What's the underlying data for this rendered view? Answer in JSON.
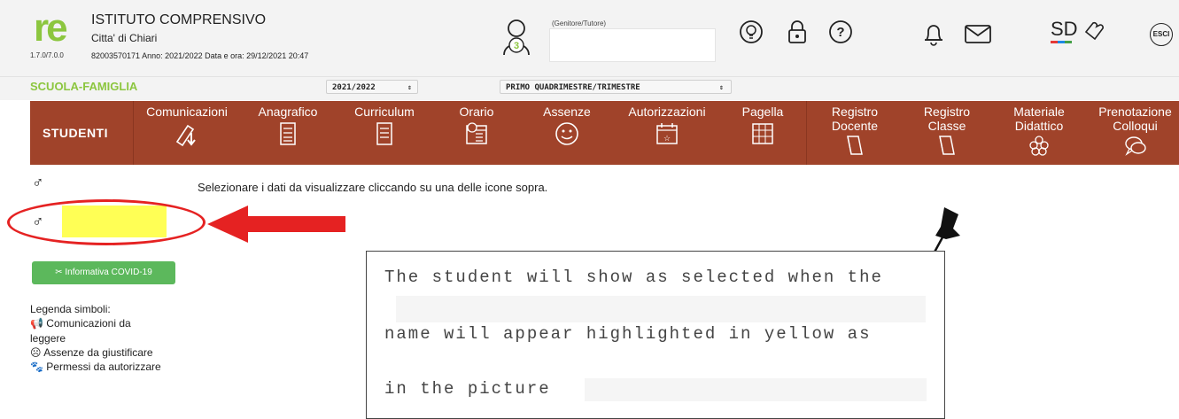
{
  "header": {
    "logo_text": "re",
    "version": "1.7.0/7.0.0",
    "school_name": "ISTITUTO COMPRENSIVO",
    "school_city": "Citta' di Chiari",
    "school_meta": "82003570171   Anno: 2021/2022  Data e ora: 29/12/2021 20:47",
    "user_badge": "3",
    "user_role": "(Genitore/Tutore)",
    "sd_label": "SD",
    "esci_label": "ESCI"
  },
  "subbar": {
    "title": "SCUOLA-FAMIGLIA",
    "year_select": "2021/2022",
    "period_select": "PRIMO QUADRIMESTRE/TRIMESTRE"
  },
  "nav": {
    "studenti": "STUDENTI",
    "items": [
      {
        "label": "Comunicazioni",
        "icon": "megaphone-icon"
      },
      {
        "label": "Anagrafico",
        "icon": "id-card-icon"
      },
      {
        "label": "Curriculum",
        "icon": "document-icon"
      },
      {
        "label": "Orario",
        "icon": "calendar-clock-icon"
      },
      {
        "label": "Assenze",
        "icon": "smiley-icon"
      },
      {
        "label": "Autorizzazioni",
        "icon": "calendar-star-icon"
      },
      {
        "label": "Pagella",
        "icon": "report-card-icon"
      },
      {
        "label_1": "Registro",
        "label_2": "Docente",
        "icon": "book-icon"
      },
      {
        "label_1": "Registro",
        "label_2": "Classe",
        "icon": "book-icon"
      },
      {
        "label_1": "Materiale",
        "label_2": "Didattico",
        "icon": "flower-icon"
      },
      {
        "label_1": "Prenotazione",
        "label_2": "Colloqui",
        "icon": "chat-icon"
      }
    ]
  },
  "content": {
    "gender_symbol": "♂",
    "instruction": "Selezionare i dati da visualizzare cliccando su una delle icone sopra.",
    "covid_button": "Informativa COVID-19",
    "legend_title": "Legenda simboli:",
    "legend_comunicazioni_1": "Comunicazioni da",
    "legend_comunicazioni_2": "leggere",
    "legend_assenze": "Assenze da giustificare",
    "legend_permessi": "Permessi da autorizzare"
  },
  "note": {
    "line1": "The student will show as selected when the",
    "line2": "name will appear highlighted in yellow as",
    "line3": "in the picture"
  },
  "colors": {
    "brand_green": "#8cc63f",
    "nav_brown": "#a0432a",
    "highlight_yellow": "#ffff55",
    "arrow_red": "#e52222",
    "covid_green": "#5cb85c"
  }
}
